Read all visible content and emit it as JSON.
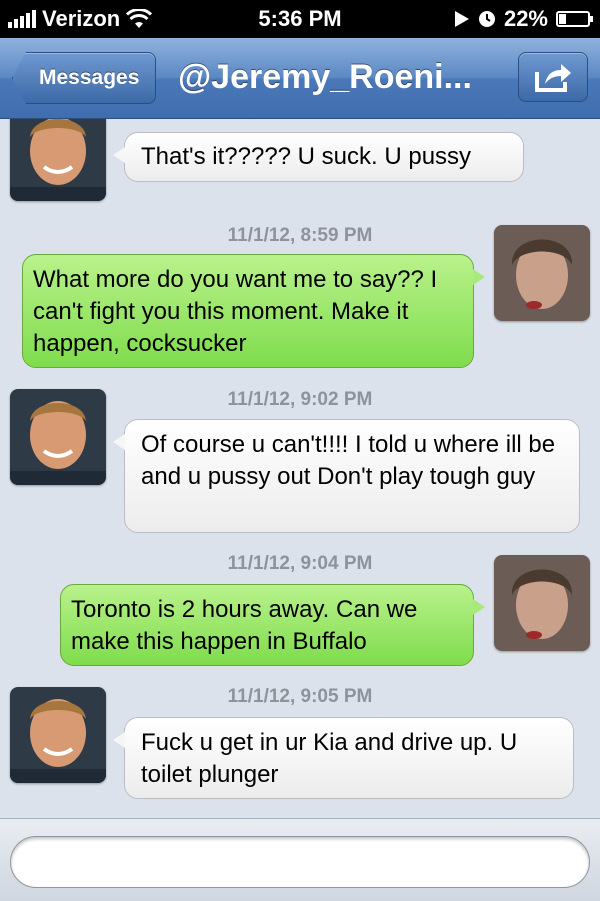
{
  "status_bar": {
    "carrier": "Verizon",
    "time": "5:36 PM",
    "battery": "22%",
    "battery_level": 0.22,
    "icons": [
      "signal-bars-icon",
      "wifi-icon",
      "location-arrow-icon",
      "alarm-clock-icon",
      "battery-icon"
    ]
  },
  "nav": {
    "back_label": "Messages",
    "title": "@Jeremy_Roeni...",
    "share_icon": "share-arrow-icon"
  },
  "messages": [
    {
      "side": "left",
      "text": "That's it????? U suck.  U pussy"
    },
    {
      "timestamp": "11/1/12, 8:59 PM",
      "side": "right",
      "text": "What more do you want me to say?? I can't fight you this moment. Make it happen, cocksucker"
    },
    {
      "timestamp": "11/1/12, 9:02 PM",
      "side": "left",
      "text": "Of course u can't!!!! I told u where ill be and u pussy out   Don't play tough guy"
    },
    {
      "timestamp": "11/1/12, 9:04 PM",
      "side": "right",
      "text": "Toronto is 2 hours away. Can we make this happen in Buffalo"
    },
    {
      "timestamp": "11/1/12, 9:05 PM",
      "side": "left",
      "text": "Fuck u get in ur Kia and drive up. U toilet plunger"
    }
  ],
  "input": {
    "value": "",
    "placeholder": ""
  },
  "colors": {
    "nav_blue": "#4a78b8",
    "incoming_bubble": "#ececec",
    "outgoing_bubble": "#7fdc4c",
    "background": "#dbe2ec",
    "timestamp": "#8e939b"
  }
}
